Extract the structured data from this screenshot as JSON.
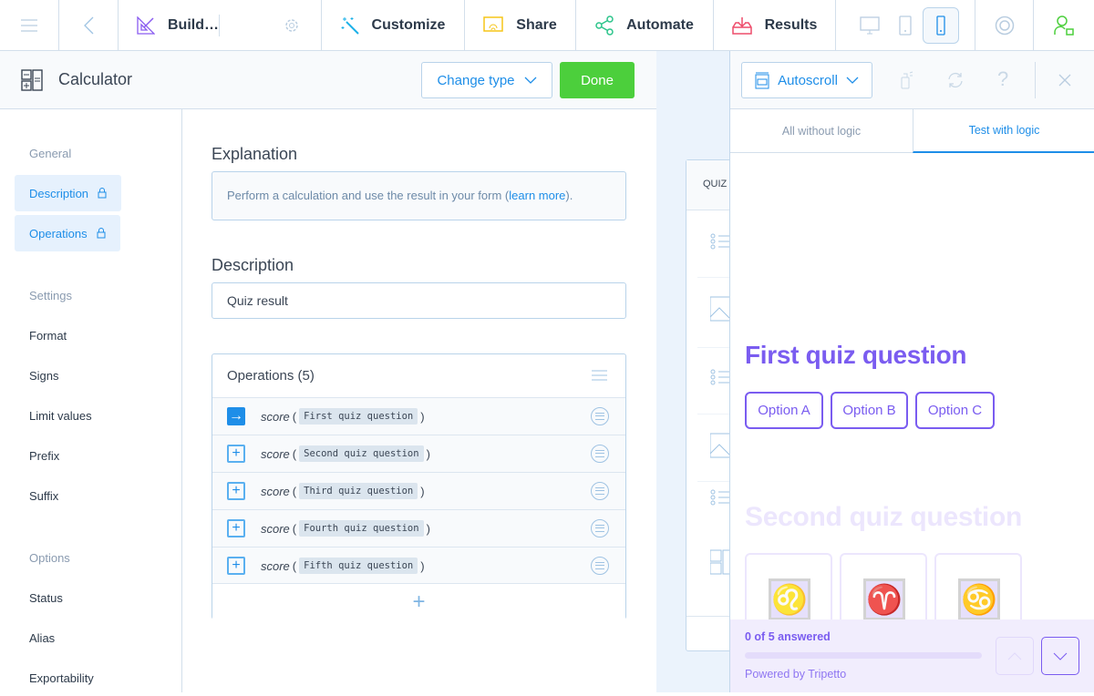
{
  "topbar": {
    "build_label": "Build…",
    "customize_label": "Customize",
    "share_label": "Share",
    "automate_label": "Automate",
    "results_label": "Results",
    "active_device": "phone"
  },
  "editor": {
    "block_type": "Calculator",
    "change_type_label": "Change type",
    "done_label": "Done",
    "sidebar": {
      "sections": [
        {
          "title": "General",
          "items": [
            {
              "label": "Description",
              "locked": true,
              "active": true
            },
            {
              "label": "Operations",
              "locked": true,
              "active": true
            }
          ]
        },
        {
          "title": "Settings",
          "items": [
            {
              "label": "Format"
            },
            {
              "label": "Signs"
            },
            {
              "label": "Limit values"
            },
            {
              "label": "Prefix"
            },
            {
              "label": "Suffix"
            }
          ]
        },
        {
          "title": "Options",
          "items": [
            {
              "label": "Status"
            },
            {
              "label": "Alias"
            },
            {
              "label": "Exportability"
            }
          ]
        }
      ]
    },
    "explanation_title": "Explanation",
    "explanation_text": "Perform a calculation and use the result in your form (",
    "explanation_link": "learn more",
    "explanation_end": ").",
    "description_title": "Description",
    "description_value": "Quiz result",
    "operations_title": "Operations (5)",
    "operations": [
      {
        "func": "score",
        "arg": "First quiz question",
        "icon": "arrow-right"
      },
      {
        "func": "score",
        "arg": "Second quiz question",
        "icon": "plus"
      },
      {
        "func": "score",
        "arg": "Third quiz question",
        "icon": "plus"
      },
      {
        "func": "score",
        "arg": "Fourth quiz question",
        "icon": "plus"
      },
      {
        "func": "score",
        "arg": "Fifth quiz question",
        "icon": "plus"
      }
    ],
    "paren_open": "(",
    "paren_close": ")",
    "add_label": "+"
  },
  "map": {
    "header": "QUIZ"
  },
  "preview": {
    "mode_label": "Autoscroll",
    "tabs": [
      {
        "label": "All without logic",
        "active": false
      },
      {
        "label": "Test with logic",
        "active": true
      }
    ],
    "q1_title": "First quiz question",
    "q1_options": [
      "Option A",
      "Option B",
      "Option C"
    ],
    "q2_title": "Second quiz question",
    "q2_images": [
      "♌",
      "♈",
      "♋"
    ],
    "progress_text": "0 of 5 answered",
    "progress": 0,
    "powered_by": "Powered by Tripetto",
    "accent": "#7a5cf0"
  }
}
